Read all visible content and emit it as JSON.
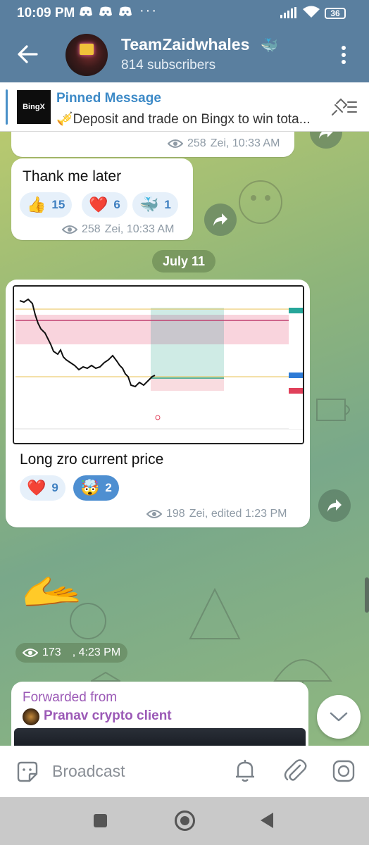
{
  "status_bar": {
    "time": "10:09 PM",
    "dots": "···",
    "battery": "36"
  },
  "header": {
    "channel_name": "TeamZaidwhales",
    "channel_emoji": "🐳",
    "subscribers": "814 subscribers"
  },
  "pinned": {
    "label": "Pinned Message",
    "text": "🎺Deposit and trade on Bingx to win tota...",
    "thumb_text": "BingX"
  },
  "messages": [
    {
      "views": "258",
      "meta": "Zei, 10:33 AM"
    },
    {
      "text": "Thank me later",
      "reactions": [
        {
          "emoji": "👍",
          "count": "15"
        },
        {
          "emoji": "❤️",
          "count": "6"
        },
        {
          "emoji": "🐳",
          "count": "1"
        }
      ],
      "views": "258",
      "meta": "Zei, 10:33 AM"
    }
  ],
  "date_separator": "July 11",
  "chart_post": {
    "caption": "Long zro current price",
    "reactions": [
      {
        "emoji": "❤️",
        "count": "9"
      },
      {
        "emoji": "🤯",
        "count": "2"
      }
    ],
    "views": "198",
    "meta": "Zei, edited 1:23 PM"
  },
  "hand_post": {
    "emoji": "🫴",
    "views": "173",
    "meta": ", 4:23 PM"
  },
  "forwarded": {
    "label": "Forwarded from",
    "source": "Pranav crypto client"
  },
  "composer": {
    "placeholder": "Broadcast"
  },
  "colors": {
    "header": "#5a7f9f",
    "accent": "#3d8ac7",
    "forward": "#9b59b6",
    "reaction_selected": "#4e8fd1"
  }
}
